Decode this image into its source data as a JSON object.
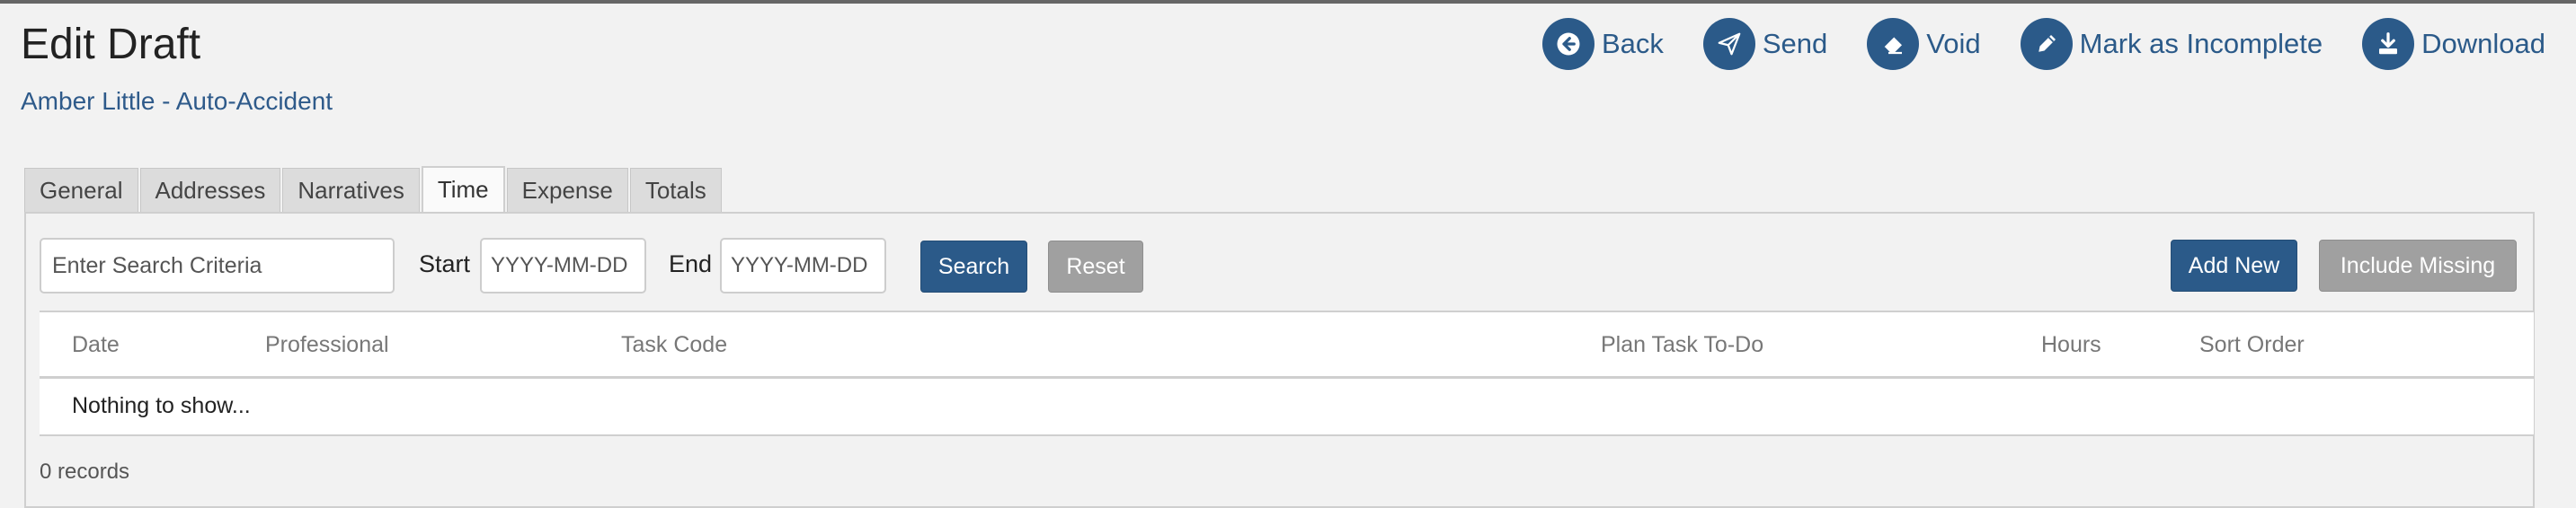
{
  "page": {
    "title": "Edit Draft",
    "subtitle": "Amber Little - Auto-Accident"
  },
  "actions": [
    {
      "label": "Back",
      "icon": "arrow-left-icon"
    },
    {
      "label": "Send",
      "icon": "paper-plane-icon"
    },
    {
      "label": "Void",
      "icon": "eraser-icon"
    },
    {
      "label": "Mark as Incomplete",
      "icon": "pencil-icon"
    },
    {
      "label": "Download",
      "icon": "download-icon"
    }
  ],
  "tabs": [
    {
      "label": "General"
    },
    {
      "label": "Addresses"
    },
    {
      "label": "Narratives"
    },
    {
      "label": "Time",
      "active": true
    },
    {
      "label": "Expense"
    },
    {
      "label": "Totals"
    }
  ],
  "filters": {
    "search_placeholder": "Enter Search Criteria",
    "start_label": "Start",
    "start_placeholder": "YYYY-MM-DD",
    "end_label": "End",
    "end_placeholder": "YYYY-MM-DD",
    "search_button": "Search",
    "reset_button": "Reset",
    "add_new_button": "Add New",
    "include_missing_button": "Include Missing"
  },
  "table": {
    "columns": [
      "Date",
      "Professional",
      "Task Code",
      "Plan Task To-Do",
      "Hours",
      "Sort Order"
    ],
    "empty_message": "Nothing to show..."
  },
  "footer": {
    "records": "0 records"
  },
  "colors": {
    "accent": "#2b5a89",
    "muted_button": "#a0a0a0",
    "background": "#f2f2f2"
  }
}
